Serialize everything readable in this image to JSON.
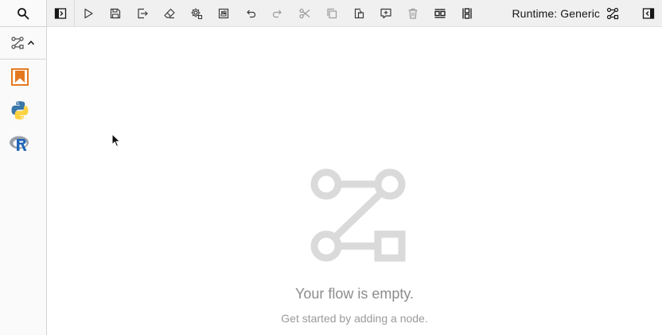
{
  "toolbar": {
    "runtime_label": "Runtime: Generic",
    "icons": [
      "toggle-palette-icon",
      "run-icon",
      "save-icon",
      "export-icon",
      "clear-icon",
      "properties-icon",
      "open-panel-icon",
      "undo-icon",
      "redo-icon",
      "cut-icon",
      "copy-icon",
      "paste-icon",
      "add-comment-icon",
      "delete-icon",
      "arrange-horizontal-icon",
      "arrange-vertical-icon"
    ]
  },
  "palette": {
    "items": [
      {
        "name": "bookmark-node",
        "icon": "orange-bookmark-icon"
      },
      {
        "name": "python-node",
        "icon": "python-icon"
      },
      {
        "name": "r-node",
        "icon": "r-icon"
      }
    ]
  },
  "canvas": {
    "empty_title": "Your flow is empty.",
    "empty_subtitle": "Get started by adding a node."
  },
  "colors": {
    "toolbar_bg": "#f0f0f0",
    "icon": "#3a3a3a",
    "empty_icon": "#dadada",
    "empty_text": "#8c8c8c",
    "bookmark_orange": "#e57921"
  }
}
